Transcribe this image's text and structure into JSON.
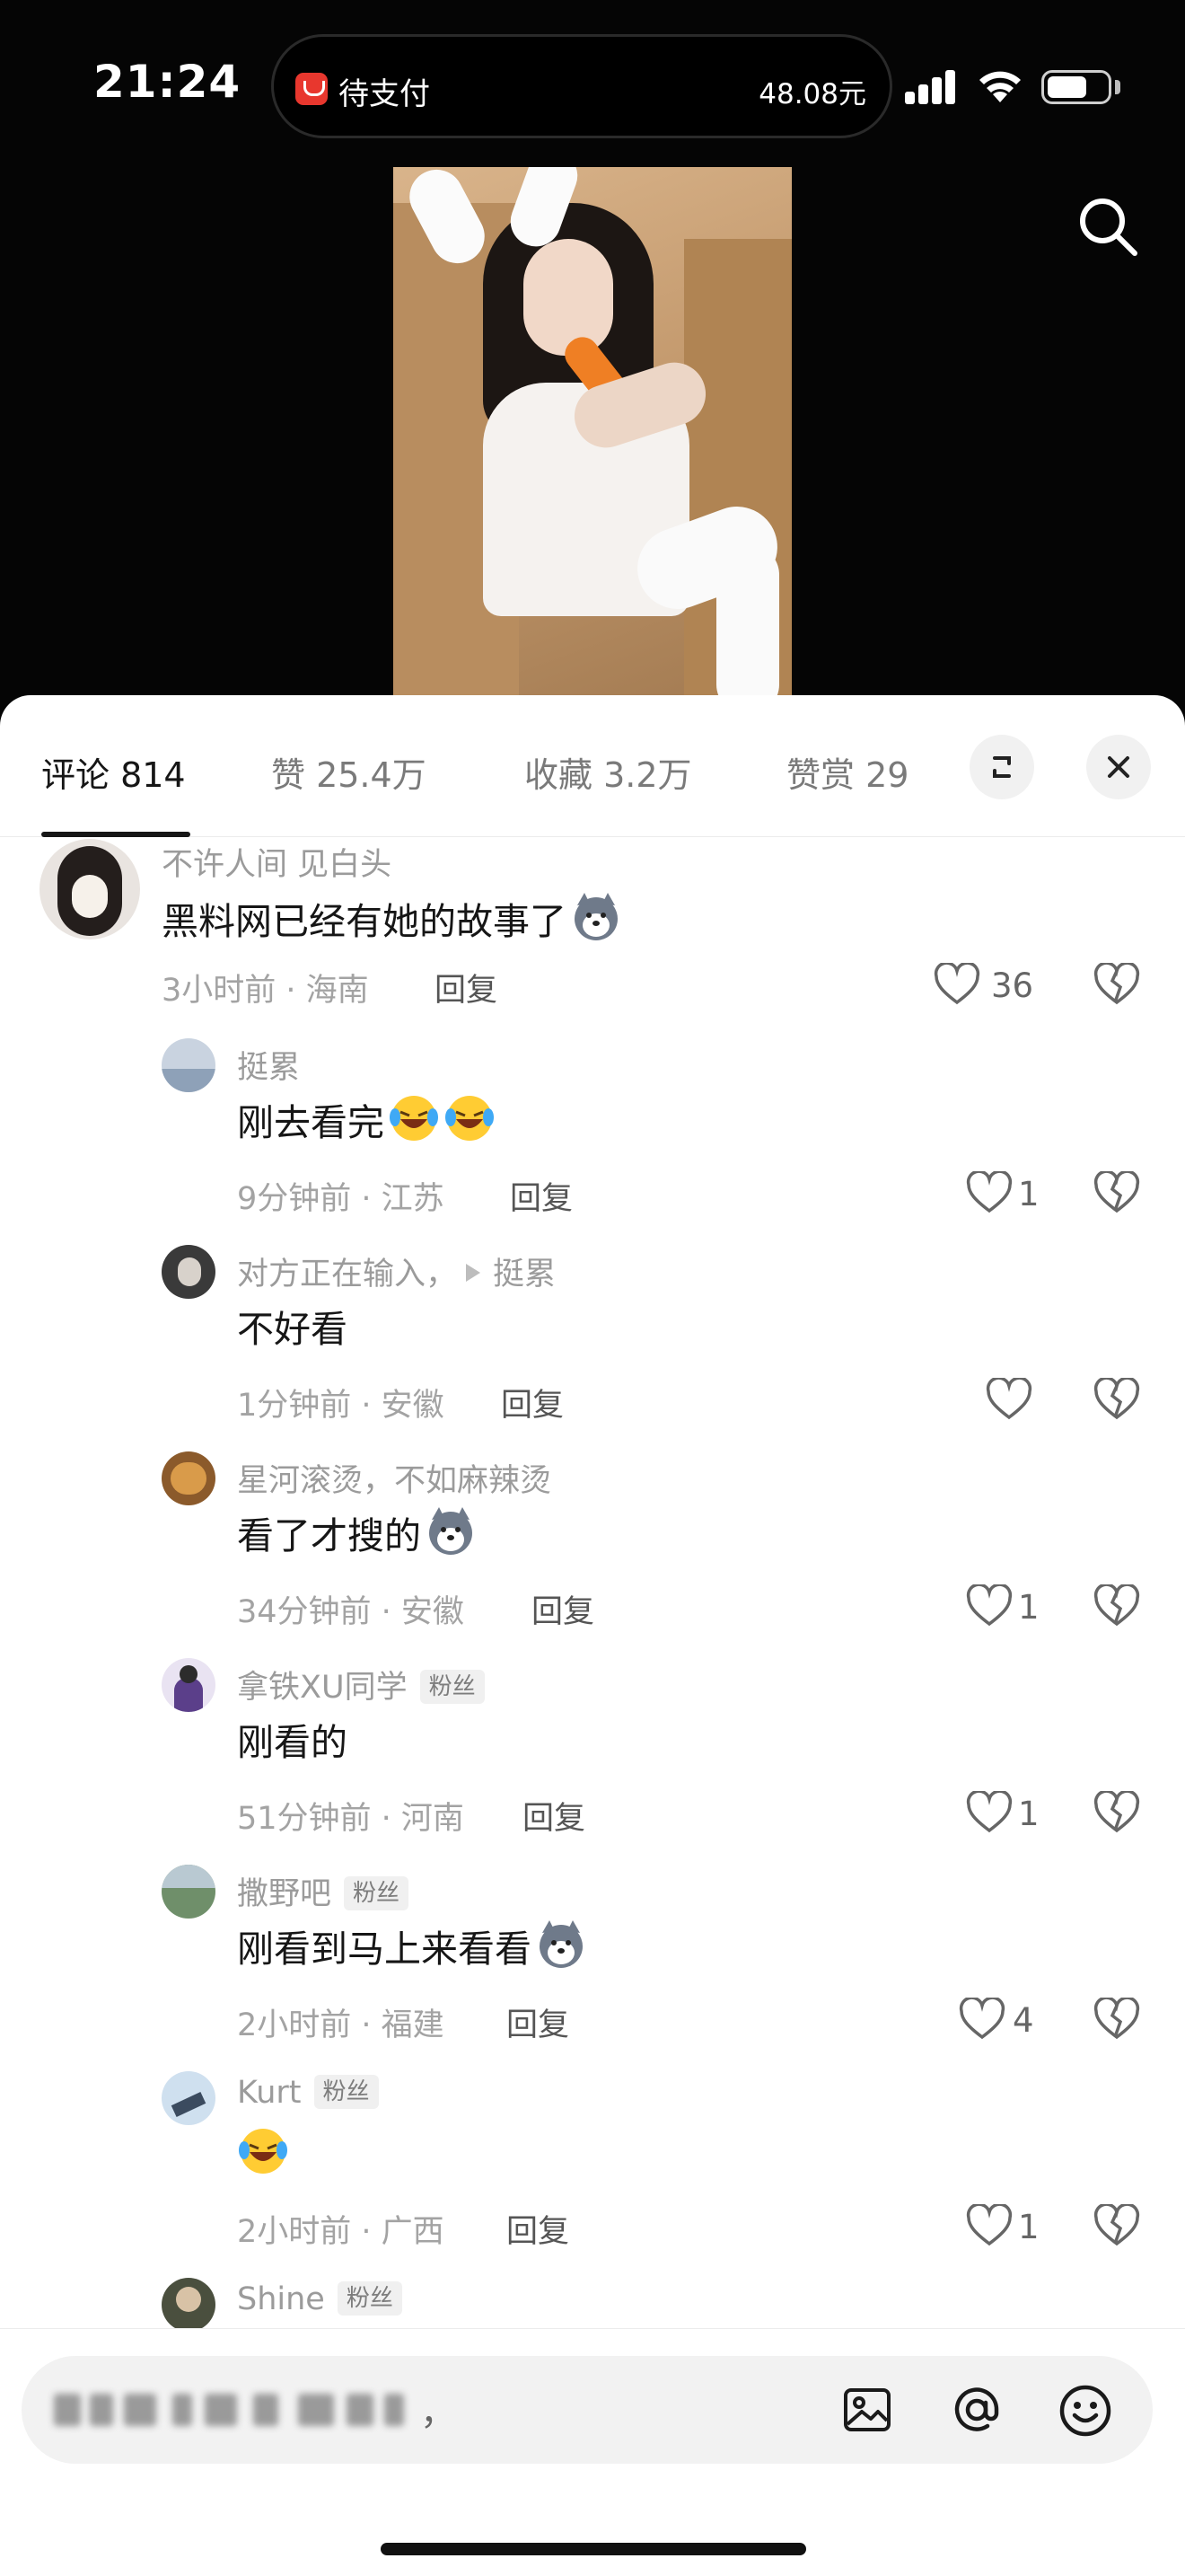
{
  "status_bar": {
    "time": "21:24",
    "island_left": "待支付",
    "island_right": "48.08元",
    "battery_level": 0.65
  },
  "video": {
    "search_icon": "search-icon"
  },
  "tabs": {
    "comments": "评论 814",
    "likes": "赞 25.4万",
    "favorites": "收藏 3.2万",
    "tips": "赞赏 29",
    "expand_icon": "expand-icon",
    "close_icon": "close-icon"
  },
  "comments": [
    {
      "user": "不许人间 见白头",
      "text": "黑料网已经有她的故事了",
      "emoji": "husky-emoji",
      "meta": "3小时前 · 海南",
      "reply": "回复",
      "likes": "36"
    },
    {
      "user": "挺累",
      "text": "刚去看完",
      "emoji": "laugh-cry-emoji-x2",
      "meta": "9分钟前 · 江苏",
      "reply": "回复",
      "likes": "1"
    },
    {
      "user": "对方正在输入，",
      "reply_to": "挺累",
      "text": "不好看",
      "meta": "1分钟前 · 安徽",
      "reply": "回复",
      "likes": ""
    },
    {
      "user": "星河滚烫，不如麻辣烫",
      "text": "看了才搜的",
      "emoji": "husky-emoji",
      "meta": "34分钟前 · 安徽",
      "reply": "回复",
      "likes": "1"
    },
    {
      "user": "拿铁XU同学",
      "badge": "粉丝",
      "text": "刚看的",
      "meta": "51分钟前 · 河南",
      "reply": "回复",
      "likes": "1"
    },
    {
      "user": "撒野吧",
      "badge": "粉丝",
      "text": "刚看到马上来看看",
      "emoji": "husky-emoji",
      "meta": "2小时前 · 福建",
      "reply": "回复",
      "likes": "4"
    },
    {
      "user": "Kurt",
      "badge": "粉丝",
      "text": "",
      "emoji": "laugh-cry-emoji",
      "meta": "2小时前 · 广西",
      "reply": "回复",
      "likes": "1"
    },
    {
      "user": "Shine",
      "badge": "粉丝"
    }
  ],
  "input": {
    "placeholder_end": "，",
    "image_icon": "image-icon",
    "at_icon": "at-icon",
    "emoji_icon": "emoji-icon"
  },
  "colors": {
    "sheet_bg": "#ffffff",
    "top_bg": "#050505",
    "text_primary": "#161616",
    "text_secondary": "#9b9b9b"
  }
}
